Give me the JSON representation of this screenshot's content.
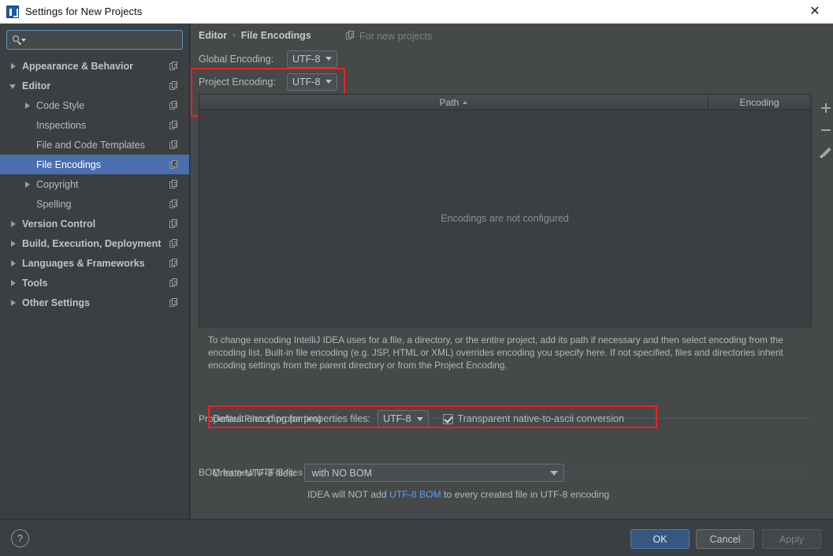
{
  "window": {
    "title": "Settings for New Projects",
    "app_icon": "intellij-idea-icon",
    "close_label": "✕"
  },
  "sidebar": {
    "search": {
      "value": "",
      "placeholder": "",
      "icon": "search-icon"
    },
    "items": [
      {
        "label": "Appearance & Behavior",
        "indent": 0,
        "twisty": "collapsed",
        "bold": true,
        "selected": false,
        "copy": true
      },
      {
        "label": "Editor",
        "indent": 0,
        "twisty": "expanded",
        "bold": true,
        "selected": false,
        "copy": true
      },
      {
        "label": "Code Style",
        "indent": 1,
        "twisty": "collapsed",
        "bold": false,
        "selected": false,
        "copy": true
      },
      {
        "label": "Inspections",
        "indent": 1,
        "twisty": "none",
        "bold": false,
        "selected": false,
        "copy": true
      },
      {
        "label": "File and Code Templates",
        "indent": 1,
        "twisty": "none",
        "bold": false,
        "selected": false,
        "copy": true
      },
      {
        "label": "File Encodings",
        "indent": 1,
        "twisty": "none",
        "bold": false,
        "selected": true,
        "copy": true
      },
      {
        "label": "Copyright",
        "indent": 1,
        "twisty": "collapsed",
        "bold": false,
        "selected": false,
        "copy": true
      },
      {
        "label": "Spelling",
        "indent": 1,
        "twisty": "none",
        "bold": false,
        "selected": false,
        "copy": true
      },
      {
        "label": "Version Control",
        "indent": 0,
        "twisty": "collapsed",
        "bold": true,
        "selected": false,
        "copy": true
      },
      {
        "label": "Build, Execution, Deployment",
        "indent": 0,
        "twisty": "collapsed",
        "bold": true,
        "selected": false,
        "copy": true
      },
      {
        "label": "Languages & Frameworks",
        "indent": 0,
        "twisty": "collapsed",
        "bold": true,
        "selected": false,
        "copy": true
      },
      {
        "label": "Tools",
        "indent": 0,
        "twisty": "collapsed",
        "bold": true,
        "selected": false,
        "copy": true
      },
      {
        "label": "Other Settings",
        "indent": 0,
        "twisty": "collapsed",
        "bold": true,
        "selected": false,
        "copy": true
      }
    ]
  },
  "content": {
    "breadcrumb": {
      "parent": "Editor",
      "separator": "›",
      "current": "File Encodings"
    },
    "for_new_projects": {
      "label": "For new projects",
      "icon": "copy-icon"
    },
    "global_encoding": {
      "label": "Global Encoding:",
      "value": "UTF-8"
    },
    "project_encoding": {
      "label": "Project Encoding:",
      "value": "UTF-8"
    },
    "table": {
      "columns": [
        "Path",
        "Encoding"
      ],
      "sort_column": "Path",
      "sort_direction": "ascending",
      "rows": [],
      "empty_message": "Encodings are not configured",
      "toolbar": [
        {
          "name": "add",
          "icon": "plus-icon"
        },
        {
          "name": "remove",
          "icon": "minus-icon"
        },
        {
          "name": "edit",
          "icon": "pencil-icon"
        }
      ]
    },
    "description": "To change encoding IntelliJ IDEA uses for a file, a directory, or the entire project, add its path if necessary and then select encoding from the encoding list. Built-in file encoding (e.g. JSP, HTML or XML) overrides encoding you specify here. If not specified, files and directories inherit encoding settings from the parent directory or from the Project Encoding.",
    "properties_group": {
      "title": "Properties Files (*.properties)",
      "default_encoding_label": "Default encoding for properties files:",
      "default_encoding_value": "UTF-8",
      "transparent_label": "Transparent native-to-ascii conversion",
      "transparent_checked": true
    },
    "bom_group": {
      "title": "BOM for new UTF-8 files",
      "create_label": "Create UTF-8 files:",
      "create_value": "with NO BOM",
      "note_prefix": "IDEA will NOT add ",
      "note_link": "UTF-8 BOM",
      "note_suffix": " to every created file in UTF-8 encoding"
    }
  },
  "footer": {
    "help_label": "?",
    "ok_label": "OK",
    "cancel_label": "Cancel",
    "apply_label": "Apply"
  },
  "annotations": {
    "highlight_color": "#f02020",
    "boxes": [
      "encoding-fields",
      "properties-default-encoding"
    ]
  },
  "colors": {
    "selection": "#4b6eaf",
    "panel_bg": "#45494a",
    "sidebar_bg": "#3c3f41",
    "link": "#589df6",
    "ok_button": "#365880"
  }
}
